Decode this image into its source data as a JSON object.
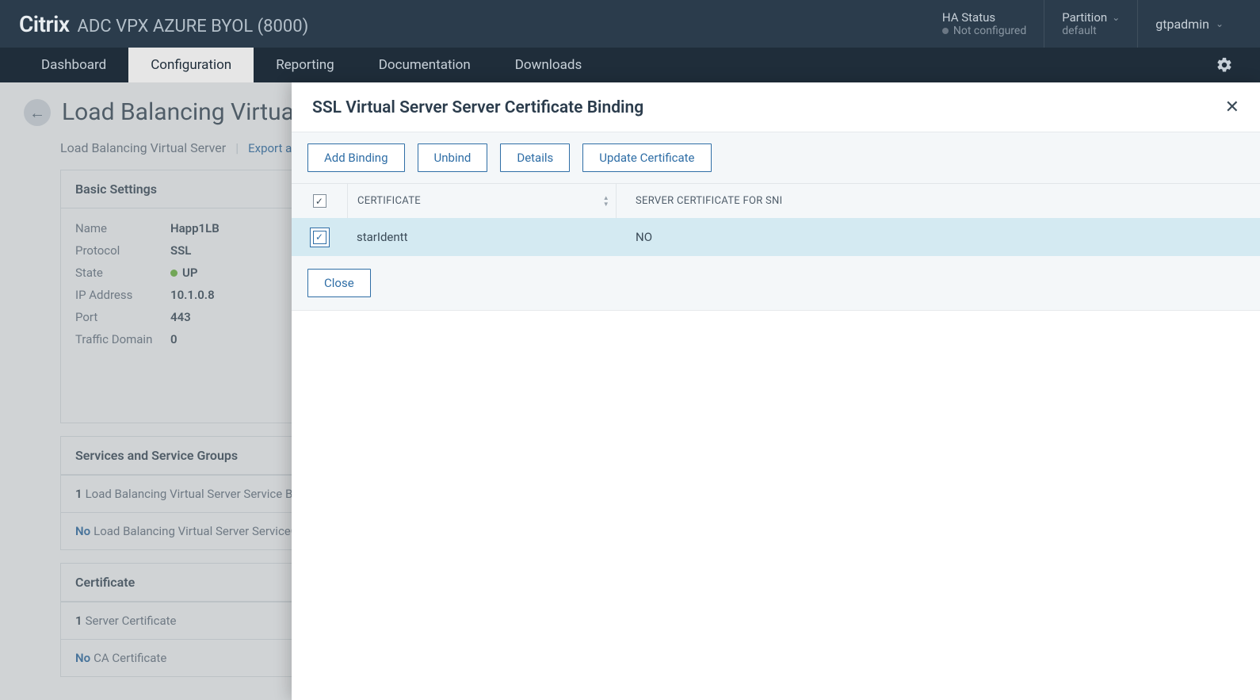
{
  "brand": {
    "main": "Citrix",
    "sub": "ADC VPX AZURE BYOL (8000)"
  },
  "header": {
    "ha_status": {
      "label": "HA Status",
      "value": "Not configured"
    },
    "partition": {
      "label": "Partition",
      "value": "default"
    },
    "user": "gtpadmin"
  },
  "nav": {
    "tabs": [
      "Dashboard",
      "Configuration",
      "Reporting",
      "Documentation",
      "Downloads"
    ],
    "active": "Configuration"
  },
  "page": {
    "title": "Load Balancing Virtual Server",
    "breadcrumb": {
      "item": "Load Balancing Virtual Server",
      "action": "Export as a Template"
    },
    "basic": {
      "head": "Basic Settings",
      "name_label": "Name",
      "name": "Happ1LB",
      "protocol_label": "Protocol",
      "protocol": "SSL",
      "state_label": "State",
      "state": "UP",
      "ip_label": "IP Address",
      "ip": "10.1.0.8",
      "port_label": "Port",
      "port": "443",
      "td_label": "Traffic Domain",
      "td": "0"
    },
    "services": {
      "head": "Services and Service Groups",
      "row1_count": "1",
      "row1_text": "Load Balancing Virtual Server Service Binding",
      "row2_no": "No",
      "row2_text": "Load Balancing Virtual Server ServiceGroup Binding"
    },
    "cert": {
      "head": "Certificate",
      "row1_count": "1",
      "row1_text": "Server Certificate",
      "row2_no": "No",
      "row2_text": "CA Certificate"
    }
  },
  "modal": {
    "title": "SSL Virtual Server Server Certificate Binding",
    "buttons": {
      "add": "Add Binding",
      "unbind": "Unbind",
      "details": "Details",
      "update": "Update Certificate",
      "close": "Close"
    },
    "columns": {
      "cert": "CERTIFICATE",
      "sni": "SERVER CERTIFICATE FOR SNI"
    },
    "rows": [
      {
        "certificate": "starIdentt",
        "sni": "NO",
        "checked": true
      }
    ]
  }
}
